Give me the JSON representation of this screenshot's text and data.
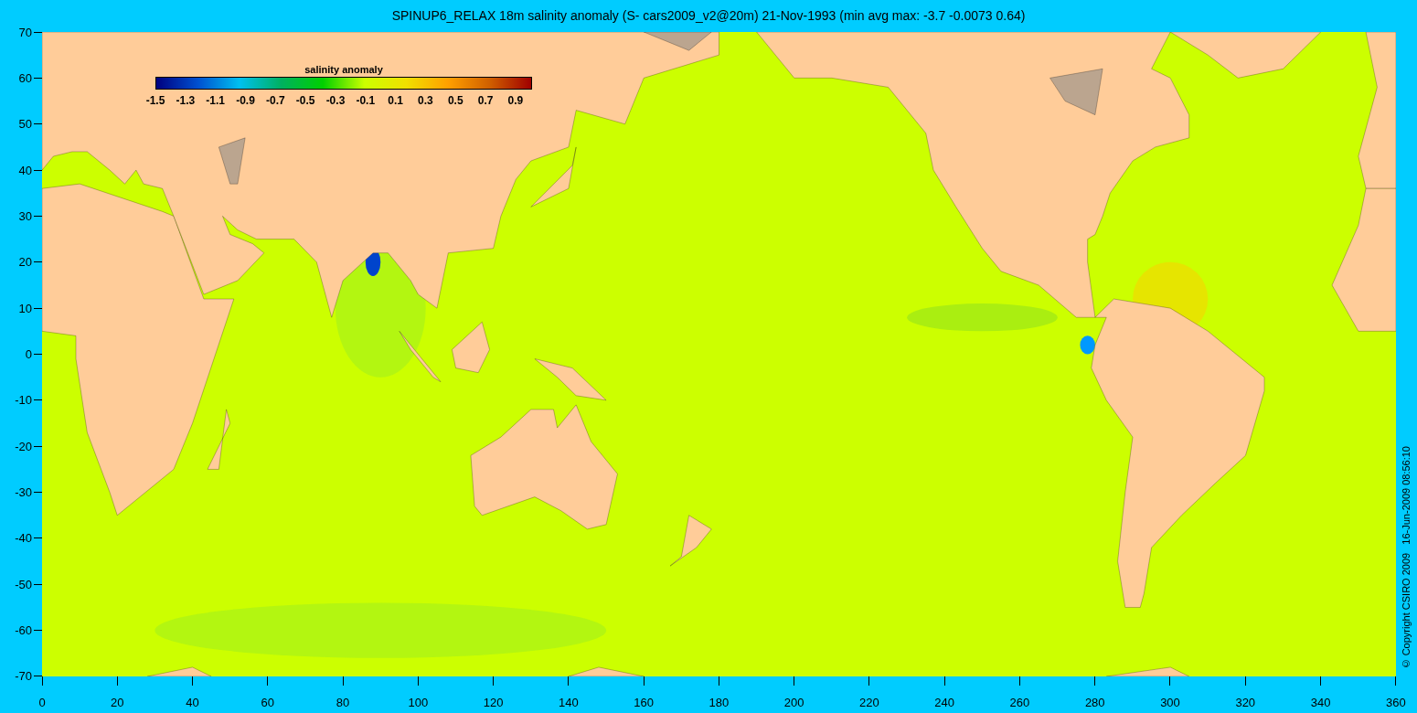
{
  "title": "SPINUP6_RELAX 18m salinity anomaly (S- cars2009_v2@20m) 21-Nov-1993 (min avg max: -3.7 -0.0073 0.64)",
  "colorbar": {
    "title": "salinity anomaly",
    "labels": [
      "-1.5",
      "-1.3",
      "-1.1",
      "-0.9",
      "-0.7",
      "-0.5",
      "-0.3",
      "-0.1",
      "0.1",
      "0.3",
      "0.5",
      "0.7",
      "0.9"
    ]
  },
  "y_axis": {
    "ticks": [
      "70",
      "60",
      "50",
      "40",
      "30",
      "20",
      "10",
      "0",
      "-10",
      "-20",
      "-30",
      "-40",
      "-50",
      "-60",
      "-70"
    ]
  },
  "x_axis": {
    "ticks": [
      "0",
      "20",
      "40",
      "60",
      "80",
      "100",
      "120",
      "140",
      "160",
      "180",
      "200",
      "220",
      "240",
      "260",
      "280",
      "300",
      "320",
      "340",
      "360"
    ]
  },
  "copyright": "© Copyright CSIRO 2009   16-Jun-2009 08:56:10"
}
